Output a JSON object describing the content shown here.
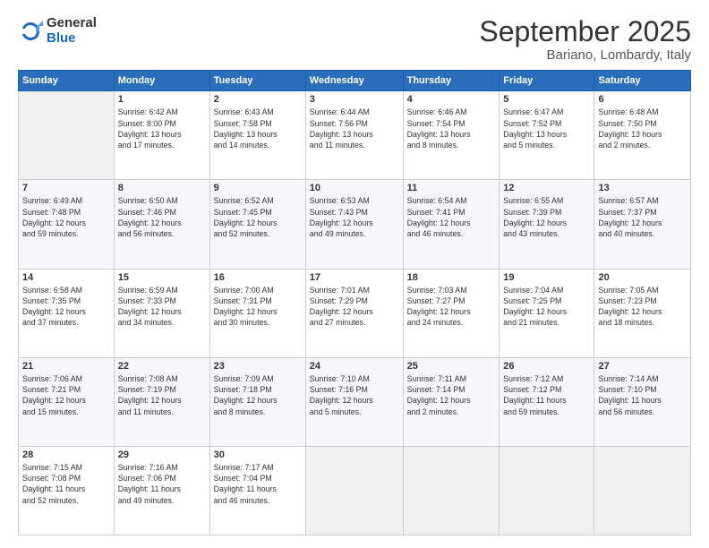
{
  "logo": {
    "general": "General",
    "blue": "Blue"
  },
  "header": {
    "month": "September 2025",
    "location": "Bariano, Lombardy, Italy"
  },
  "days_of_week": [
    "Sunday",
    "Monday",
    "Tuesday",
    "Wednesday",
    "Thursday",
    "Friday",
    "Saturday"
  ],
  "weeks": [
    [
      {
        "day": "",
        "info": ""
      },
      {
        "day": "1",
        "info": "Sunrise: 6:42 AM\nSunset: 8:00 PM\nDaylight: 13 hours\nand 17 minutes."
      },
      {
        "day": "2",
        "info": "Sunrise: 6:43 AM\nSunset: 7:58 PM\nDaylight: 13 hours\nand 14 minutes."
      },
      {
        "day": "3",
        "info": "Sunrise: 6:44 AM\nSunset: 7:56 PM\nDaylight: 13 hours\nand 11 minutes."
      },
      {
        "day": "4",
        "info": "Sunrise: 6:46 AM\nSunset: 7:54 PM\nDaylight: 13 hours\nand 8 minutes."
      },
      {
        "day": "5",
        "info": "Sunrise: 6:47 AM\nSunset: 7:52 PM\nDaylight: 13 hours\nand 5 minutes."
      },
      {
        "day": "6",
        "info": "Sunrise: 6:48 AM\nSunset: 7:50 PM\nDaylight: 13 hours\nand 2 minutes."
      }
    ],
    [
      {
        "day": "7",
        "info": "Sunrise: 6:49 AM\nSunset: 7:48 PM\nDaylight: 12 hours\nand 59 minutes."
      },
      {
        "day": "8",
        "info": "Sunrise: 6:50 AM\nSunset: 7:46 PM\nDaylight: 12 hours\nand 56 minutes."
      },
      {
        "day": "9",
        "info": "Sunrise: 6:52 AM\nSunset: 7:45 PM\nDaylight: 12 hours\nand 52 minutes."
      },
      {
        "day": "10",
        "info": "Sunrise: 6:53 AM\nSunset: 7:43 PM\nDaylight: 12 hours\nand 49 minutes."
      },
      {
        "day": "11",
        "info": "Sunrise: 6:54 AM\nSunset: 7:41 PM\nDaylight: 12 hours\nand 46 minutes."
      },
      {
        "day": "12",
        "info": "Sunrise: 6:55 AM\nSunset: 7:39 PM\nDaylight: 12 hours\nand 43 minutes."
      },
      {
        "day": "13",
        "info": "Sunrise: 6:57 AM\nSunset: 7:37 PM\nDaylight: 12 hours\nand 40 minutes."
      }
    ],
    [
      {
        "day": "14",
        "info": "Sunrise: 6:58 AM\nSunset: 7:35 PM\nDaylight: 12 hours\nand 37 minutes."
      },
      {
        "day": "15",
        "info": "Sunrise: 6:59 AM\nSunset: 7:33 PM\nDaylight: 12 hours\nand 34 minutes."
      },
      {
        "day": "16",
        "info": "Sunrise: 7:00 AM\nSunset: 7:31 PM\nDaylight: 12 hours\nand 30 minutes."
      },
      {
        "day": "17",
        "info": "Sunrise: 7:01 AM\nSunset: 7:29 PM\nDaylight: 12 hours\nand 27 minutes."
      },
      {
        "day": "18",
        "info": "Sunrise: 7:03 AM\nSunset: 7:27 PM\nDaylight: 12 hours\nand 24 minutes."
      },
      {
        "day": "19",
        "info": "Sunrise: 7:04 AM\nSunset: 7:25 PM\nDaylight: 12 hours\nand 21 minutes."
      },
      {
        "day": "20",
        "info": "Sunrise: 7:05 AM\nSunset: 7:23 PM\nDaylight: 12 hours\nand 18 minutes."
      }
    ],
    [
      {
        "day": "21",
        "info": "Sunrise: 7:06 AM\nSunset: 7:21 PM\nDaylight: 12 hours\nand 15 minutes."
      },
      {
        "day": "22",
        "info": "Sunrise: 7:08 AM\nSunset: 7:19 PM\nDaylight: 12 hours\nand 11 minutes."
      },
      {
        "day": "23",
        "info": "Sunrise: 7:09 AM\nSunset: 7:18 PM\nDaylight: 12 hours\nand 8 minutes."
      },
      {
        "day": "24",
        "info": "Sunrise: 7:10 AM\nSunset: 7:16 PM\nDaylight: 12 hours\nand 5 minutes."
      },
      {
        "day": "25",
        "info": "Sunrise: 7:11 AM\nSunset: 7:14 PM\nDaylight: 12 hours\nand 2 minutes."
      },
      {
        "day": "26",
        "info": "Sunrise: 7:12 AM\nSunset: 7:12 PM\nDaylight: 11 hours\nand 59 minutes."
      },
      {
        "day": "27",
        "info": "Sunrise: 7:14 AM\nSunset: 7:10 PM\nDaylight: 11 hours\nand 56 minutes."
      }
    ],
    [
      {
        "day": "28",
        "info": "Sunrise: 7:15 AM\nSunset: 7:08 PM\nDaylight: 11 hours\nand 52 minutes."
      },
      {
        "day": "29",
        "info": "Sunrise: 7:16 AM\nSunset: 7:06 PM\nDaylight: 11 hours\nand 49 minutes."
      },
      {
        "day": "30",
        "info": "Sunrise: 7:17 AM\nSunset: 7:04 PM\nDaylight: 11 hours\nand 46 minutes."
      },
      {
        "day": "",
        "info": ""
      },
      {
        "day": "",
        "info": ""
      },
      {
        "day": "",
        "info": ""
      },
      {
        "day": "",
        "info": ""
      }
    ]
  ]
}
